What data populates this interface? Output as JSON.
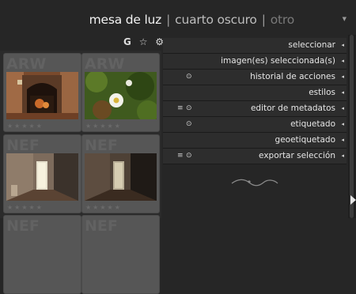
{
  "header": {
    "views": [
      {
        "label": "mesa de luz",
        "state": "active"
      },
      {
        "label": "cuarto oscuro",
        "state": "normal"
      },
      {
        "label": "otro",
        "state": "dim"
      }
    ],
    "separator": "|",
    "tools": [
      "G",
      "☆",
      "⚙"
    ]
  },
  "thumbnails": [
    {
      "ext": "ARW",
      "stars": "★★★★★",
      "scene": "fireplace"
    },
    {
      "ext": "ARW",
      "stars": "★★★★★",
      "scene": "flower"
    },
    {
      "ext": "NEF",
      "stars": "★★★★★",
      "scene": "hallway-light"
    },
    {
      "ext": "NEF",
      "stars": "★★★★★",
      "scene": "hallway-dark"
    },
    {
      "ext": "NEF",
      "stars": "",
      "scene": ""
    },
    {
      "ext": "NEF",
      "stars": "",
      "scene": ""
    }
  ],
  "panel": {
    "modules": [
      {
        "label": "seleccionar",
        "icons": []
      },
      {
        "label": "imagen(es) seleccionada(s)",
        "icons": []
      },
      {
        "label": "historial de acciones",
        "icons": [
          "reset-icon"
        ]
      },
      {
        "label": "estilos",
        "icons": []
      },
      {
        "label": "editor de metadatos",
        "icons": [
          "presets-icon",
          "reset-icon"
        ]
      },
      {
        "label": "etiquetado",
        "icons": [
          "reset-icon"
        ]
      },
      {
        "label": "geoetiquetado",
        "icons": []
      },
      {
        "label": "exportar selección",
        "icons": [
          "presets-icon",
          "reset-icon"
        ]
      }
    ],
    "expand_glyph": "◂"
  },
  "colors": {
    "background": "#262626",
    "panel_row": "#2d2d2d",
    "thumb_frame": "#565656",
    "text_active": "#f2f2f2",
    "text_dim": "#7a7a7a"
  }
}
